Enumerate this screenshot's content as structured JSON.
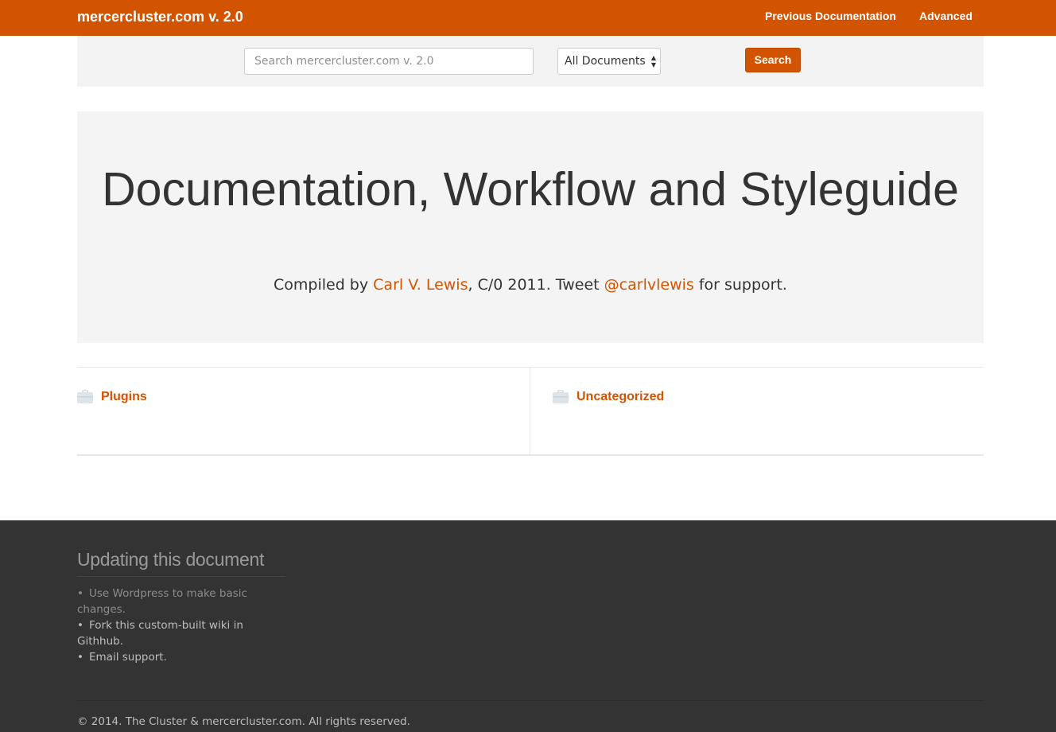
{
  "navbar": {
    "brand": "mercercluster.com v. 2.0",
    "links": [
      {
        "label": "Previous Documentation"
      },
      {
        "label": "Advanced"
      }
    ],
    "color": "#d35400"
  },
  "search": {
    "placeholder": "Search mercercluster.com v. 2.0",
    "scope_selected": "All Documents",
    "button_label": "Search"
  },
  "hero": {
    "title": "Documentation, Workflow and Styleguide",
    "sub_prefix": "Compiled by ",
    "author_link": "Carl V. Lewis",
    "sub_middle": ", C/0 2011. Tweet ",
    "twitter_link": "@carlvlewis",
    "sub_suffix": " for support."
  },
  "categories": [
    {
      "label": "Plugins",
      "icon": "briefcase-icon"
    },
    {
      "label": "Uncategorized",
      "icon": "briefcase-icon"
    }
  ],
  "footer": {
    "heading": "Updating this document",
    "items": [
      {
        "text": "Use Wordpress to make basic changes."
      },
      {
        "text": "Fork this custom-built wiki in Githhub."
      },
      {
        "text": "Email support."
      }
    ],
    "copyright": "© 2014. The Cluster & mercercluster.com. All rights reserved."
  }
}
